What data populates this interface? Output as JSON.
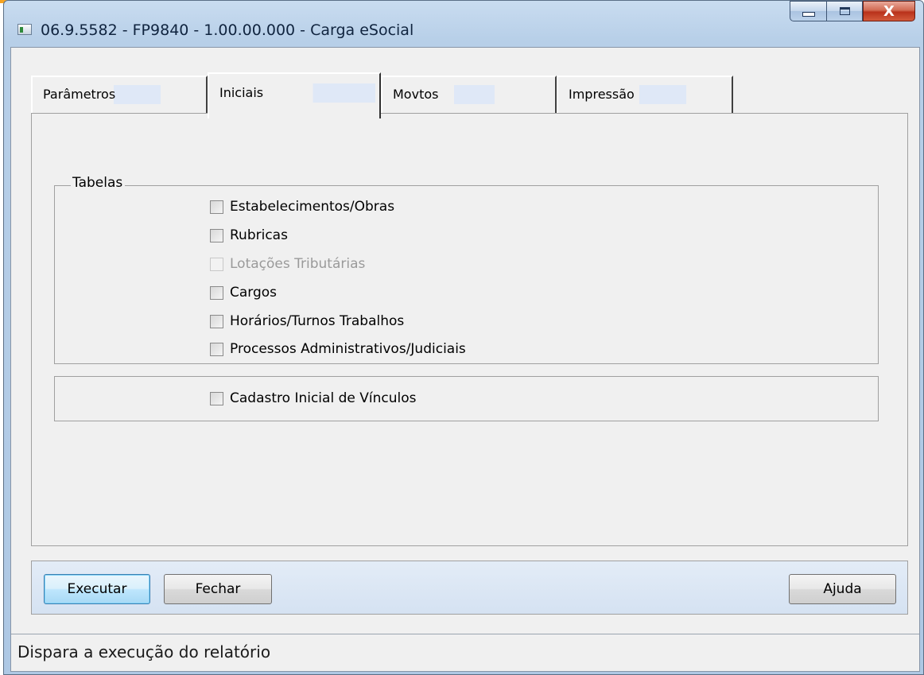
{
  "window": {
    "title": "06.9.5582 - FP9840 - 1.00.00.000 - Carga eSocial",
    "controls": {
      "minimize": "minimize",
      "maximize": "maximize",
      "close": "X"
    }
  },
  "tabs": [
    {
      "label": "Parâmetros",
      "active": false
    },
    {
      "label": "Iniciais",
      "active": true
    },
    {
      "label": "Movtos",
      "active": false
    },
    {
      "label": "Impressão",
      "active": false
    }
  ],
  "tabelas": {
    "legend": "Tabelas",
    "items": [
      {
        "label": "Estabelecimentos/Obras",
        "checked": false,
        "enabled": true
      },
      {
        "label": "Rubricas",
        "checked": false,
        "enabled": true
      },
      {
        "label": "Lotações Tributárias",
        "checked": false,
        "enabled": false
      },
      {
        "label": "Cargos",
        "checked": false,
        "enabled": true
      },
      {
        "label": "Horários/Turnos Trabalhos",
        "checked": false,
        "enabled": true
      },
      {
        "label": "Processos Administrativos/Judiciais",
        "checked": false,
        "enabled": true
      }
    ]
  },
  "vinculos": {
    "label": "Cadastro Inicial de Vínculos",
    "checked": false
  },
  "buttons": {
    "execute": "Executar",
    "close": "Fechar",
    "help": "Ajuda"
  },
  "status": {
    "text": "Dispara a execução do relatório"
  },
  "colors": {
    "titlebar": "#b7cfe8",
    "client": "#f0f0f0",
    "close_button": "#c8432a",
    "default_button": "#3c7fb1"
  }
}
